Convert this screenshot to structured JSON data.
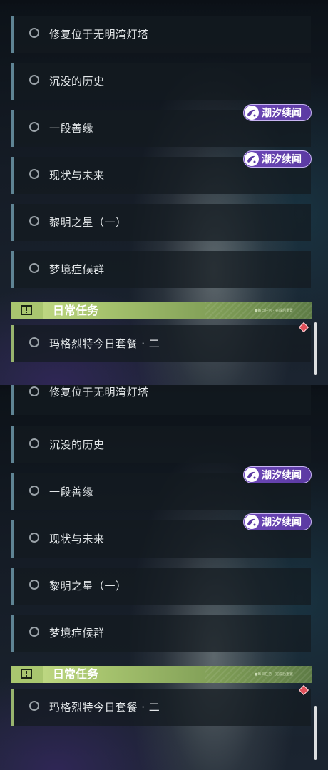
{
  "quest_items": [
    "修复位于无明湾灯塔",
    "沉没的历史",
    "一段善缘",
    "现状与未来",
    "黎明之星（一）",
    "梦境症候群"
  ],
  "badge_label": "潮汐续闻",
  "daily_section": {
    "title": "日常任务",
    "subtitle": "●每日任务 · 完成后重置",
    "item": "玛格烈特今日套餐 · 二"
  },
  "colors": {
    "badge": "#6d48b8",
    "section_header": "#a7c46e",
    "quest_border": "#5f8494",
    "alert_diamond": "#e0505a"
  },
  "icons": {
    "quest_status": "empty-circle-icon",
    "badge": "tide-swirl-icon",
    "section": "exclamation-box-icon",
    "new_marker": "diamond-icon"
  }
}
